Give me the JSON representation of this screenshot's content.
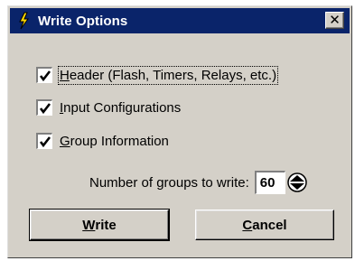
{
  "window": {
    "title": "Write Options",
    "close_glyph": "✕"
  },
  "options": [
    {
      "mnemonic": "H",
      "rest": "eader (Flash, Timers, Relays, etc.)",
      "checked": true,
      "focused": true
    },
    {
      "mnemonic": "I",
      "rest": "nput Configurations",
      "checked": true,
      "focused": false
    },
    {
      "mnemonic": "G",
      "rest": "roup Information",
      "checked": true,
      "focused": false
    }
  ],
  "groups": {
    "label": "Number of groups to write:",
    "value": "60"
  },
  "buttons": {
    "write": {
      "mnemonic": "W",
      "rest": "rite"
    },
    "cancel": {
      "mnemonic": "C",
      "rest": "ancel"
    }
  },
  "colors": {
    "titlebar": "#0a246a",
    "face": "#d4d0c8"
  },
  "icons": {
    "app": "lightning-bolt-icon",
    "close": "close-icon",
    "checkmark": "checkmark-icon",
    "spinner": "up-down-arrows-icon"
  }
}
